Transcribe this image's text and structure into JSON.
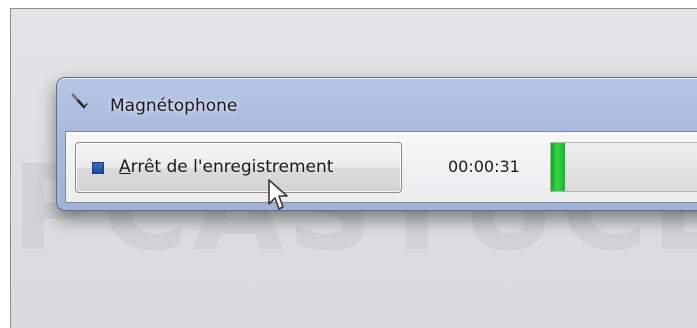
{
  "window": {
    "title": "Magnétophone",
    "title_icon": "microphone-icon"
  },
  "recorder": {
    "stop_button": {
      "label_prefix": "A",
      "label_rest": "rrêt de l'enregistrement",
      "icon": "stop-square-icon"
    },
    "elapsed_time": "00:00:31",
    "level_meter": {
      "level_fraction": 0.08
    }
  },
  "colors": {
    "stop_icon": "#2a57b4",
    "level_fill": "#22c33a"
  }
}
